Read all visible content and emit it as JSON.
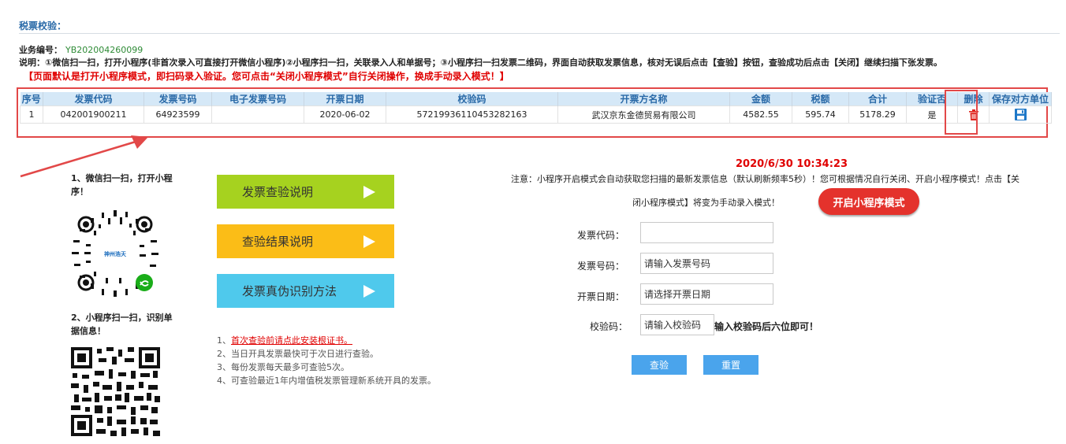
{
  "page": {
    "title": "税票校验：",
    "business_no_label": "业务编号：",
    "business_no_value": "YB202004260099",
    "description": "说明：①微信扫一扫，打开小程序(非首次录入可直接打开微信小程序)②小程序扫一扫，关联录入人和单据号；③小程序扫一扫发票二维码，界面自动获取发票信息，核对无误后点击【查验】按钮，查验成功后点击【关闭】继续扫描下张发票。",
    "warning": "【页面默认是打开小程序模式，即扫码录入验证。您可点击“关闭小程序模式”自行关闭操作，换成手动录入模式！】"
  },
  "table": {
    "headers": [
      "序号",
      "发票代码",
      "发票号码",
      "电子发票号码",
      "开票日期",
      "校验码",
      "开票方名称",
      "金额",
      "税额",
      "合计",
      "验证否",
      "删除",
      "保存对方单位"
    ],
    "rows": [
      {
        "index": "1",
        "invoice_code": "042001900211",
        "invoice_no": "64923599",
        "e_invoice_no": "",
        "issue_date": "2020-06-02",
        "check_code": "57219936110453282163",
        "issuer": "武汉京东金德贸易有限公司",
        "amount": "4582.55",
        "tax": "595.74",
        "total": "5178.29",
        "verified": "是"
      }
    ]
  },
  "left": {
    "step1": "1、微信扫一扫，打开小程序！",
    "step2": "2、小程序扫一扫，识别单据信息！",
    "qr1_logo_text": "神州浩天"
  },
  "info_buttons": {
    "guide": "发票查验说明",
    "result": "查验结果说明",
    "auth": "发票真伪识别方法"
  },
  "notes": {
    "n1_prefix": "1、",
    "n1_link": "首次查验前请点此安装根证书。",
    "n2": "2、当日开具发票最快可于次日进行查验。",
    "n3": "3、每份发票每天最多可查验5次。",
    "n4": "4、可查验最近1年内增值税发票管理新系统开具的发票。"
  },
  "form": {
    "datetime": "2020/6/30 10:34:23",
    "notice_line1": "注意：小程序开启模式会自动获取您扫描的最新发票信息（默认刷新频率5秒）！您可根据情况自行关闭、开启小程序模式！点击【关",
    "notice_line2": "闭小程序模式】将变为手动录入模式！",
    "mini_toggle_label": "开启小程序模式",
    "code_label": "发票代码：",
    "code_value": "",
    "number_label": "发票号码：",
    "number_placeholder": "请输入发票号码",
    "date_label": "开票日期：",
    "date_placeholder": "请选择开票日期",
    "check_label": "校验码：",
    "check_placeholder": "请输入校验码",
    "check_hint": "输入校验码后六位即可！",
    "verify_button": "查验",
    "reset_button": "重置"
  }
}
